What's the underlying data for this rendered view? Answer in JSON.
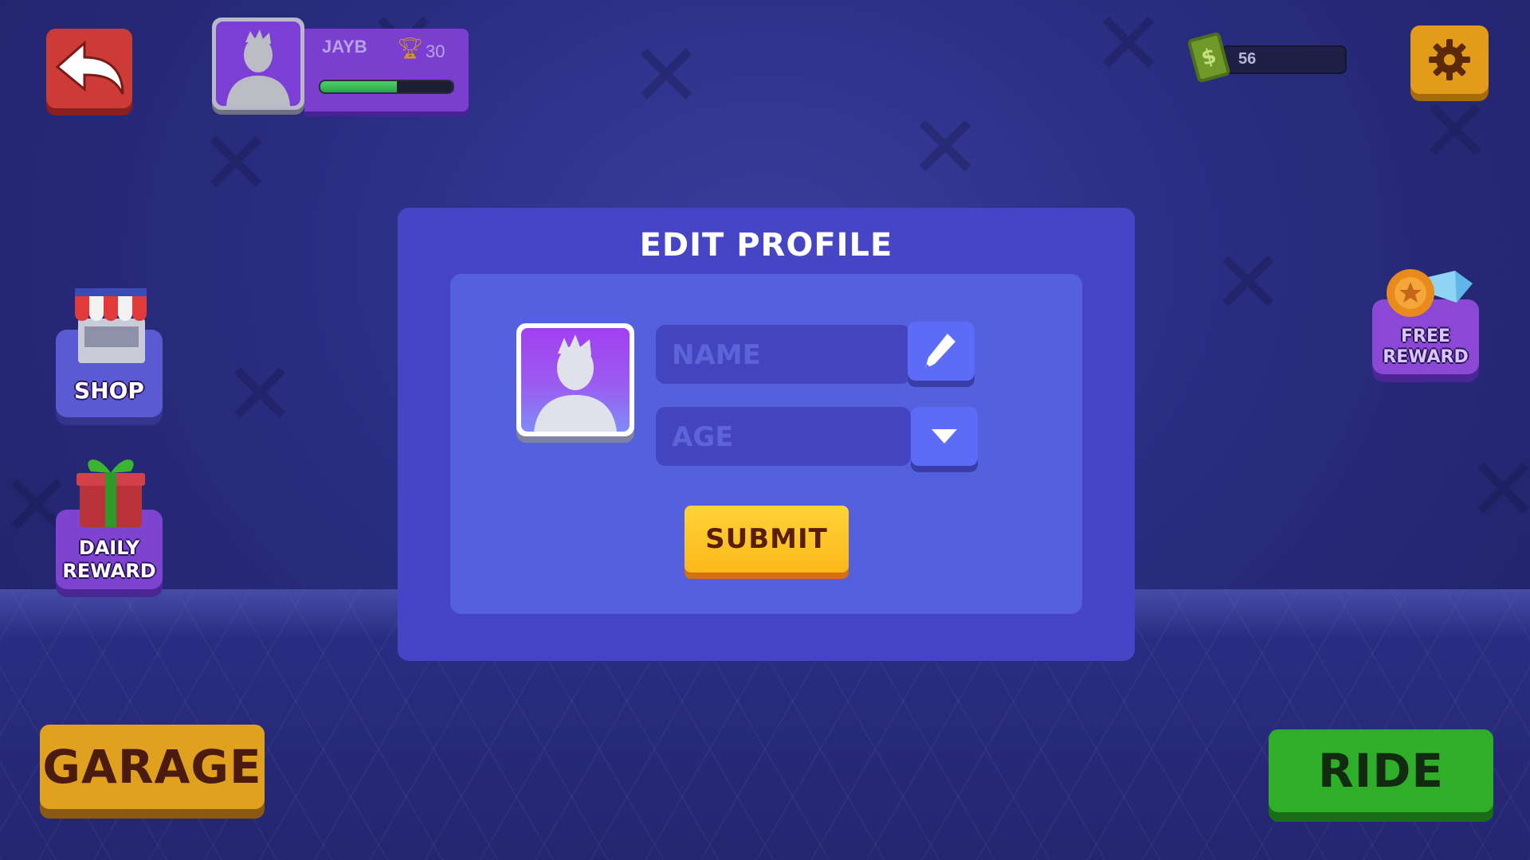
{
  "header": {
    "player_name": "JAYB",
    "trophies": "30",
    "xp_progress": 0.58,
    "currency": "56"
  },
  "side": {
    "shop_label": "SHOP",
    "daily_reward_label_1": "DAILY",
    "daily_reward_label_2": "REWARD",
    "free_reward_label_1": "FREE",
    "free_reward_label_2": "REWARD"
  },
  "modal": {
    "title": "EDIT PROFILE",
    "name_placeholder": "NAME",
    "age_placeholder": "AGE",
    "submit_label": "SUBMIT"
  },
  "bottom": {
    "garage_label": "GARAGE",
    "ride_label": "RIDE"
  },
  "icons": {
    "back": "back-arrow-icon",
    "settings": "gear-icon",
    "currency": "cash-icon",
    "trophy": "trophy-icon",
    "edit": "pencil-icon",
    "dropdown": "chevron-down-icon"
  },
  "colors": {
    "background": "#2a2c80",
    "modal": "#4545c6",
    "modal_inner": "#5560dc",
    "submit": "#fbb81a",
    "ride": "#2fae2a",
    "garage": "#e0a21e",
    "back": "#cc3b35",
    "settings": "#e39b1a"
  }
}
